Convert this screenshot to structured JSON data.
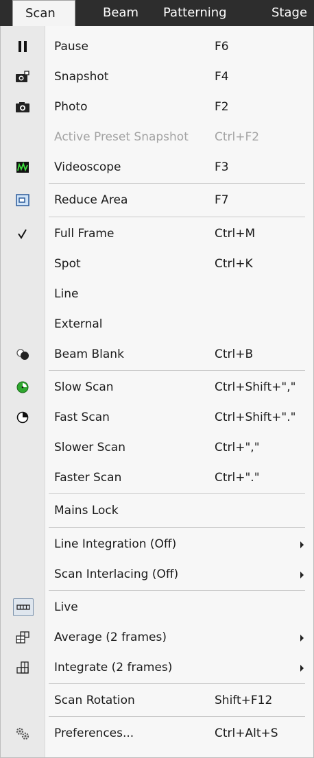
{
  "menubar": {
    "scan": "Scan",
    "beam": "Beam",
    "patterning": "Patterning",
    "stage": "Stage"
  },
  "menu": {
    "items": [
      {
        "label": "Pause",
        "shortcut": "F6",
        "icon": "pause-icon"
      },
      {
        "label": "Snapshot",
        "shortcut": "F4",
        "icon": "snapshot-camera-icon"
      },
      {
        "label": "Photo",
        "shortcut": "F2",
        "icon": "photo-camera-icon"
      },
      {
        "label": "Active Preset Snapshot",
        "shortcut": "Ctrl+F2",
        "disabled": true
      },
      {
        "label": "Videoscope",
        "shortcut": "F3",
        "icon": "videoscope-icon"
      },
      {
        "label": "Reduce Area",
        "shortcut": "F7",
        "icon": "reduce-area-icon"
      },
      {
        "label": "Full Frame",
        "shortcut": "Ctrl+M",
        "icon": "checkmark-icon"
      },
      {
        "label": "Spot",
        "shortcut": "Ctrl+K"
      },
      {
        "label": "Line",
        "shortcut": ""
      },
      {
        "label": "External",
        "shortcut": ""
      },
      {
        "label": "Beam Blank",
        "shortcut": "Ctrl+B",
        "icon": "beam-blank-icon"
      },
      {
        "label": "Slow Scan",
        "shortcut": "Ctrl+Shift+\",\"",
        "icon": "slow-scan-icon"
      },
      {
        "label": "Fast Scan",
        "shortcut": "Ctrl+Shift+\".\"",
        "icon": "fast-scan-icon"
      },
      {
        "label": "Slower Scan",
        "shortcut": "Ctrl+\",\""
      },
      {
        "label": "Faster Scan",
        "shortcut": "Ctrl+\".\""
      },
      {
        "label": "Mains Lock",
        "shortcut": ""
      },
      {
        "label": "Line Integration (Off)",
        "submenu": true
      },
      {
        "label": "Scan Interlacing (Off)",
        "submenu": true
      },
      {
        "label": "Live",
        "icon": "live-icon"
      },
      {
        "label": "Average (2 frames)",
        "submenu": true,
        "icon": "average-icon"
      },
      {
        "label": "Integrate (2 frames)",
        "submenu": true,
        "icon": "integrate-icon"
      },
      {
        "label": "Scan Rotation",
        "shortcut": "Shift+F12"
      },
      {
        "label": "Preferences...",
        "shortcut": "Ctrl+Alt+S",
        "icon": "preferences-gears-icon"
      }
    ]
  },
  "colors": {
    "menubar_bg": "#2d2d2d",
    "menu_bg": "#f7f7f7",
    "gutter_bg": "#e9e9e9",
    "disabled_text": "#a3a3a3",
    "green_accent": "#2fa82f"
  }
}
